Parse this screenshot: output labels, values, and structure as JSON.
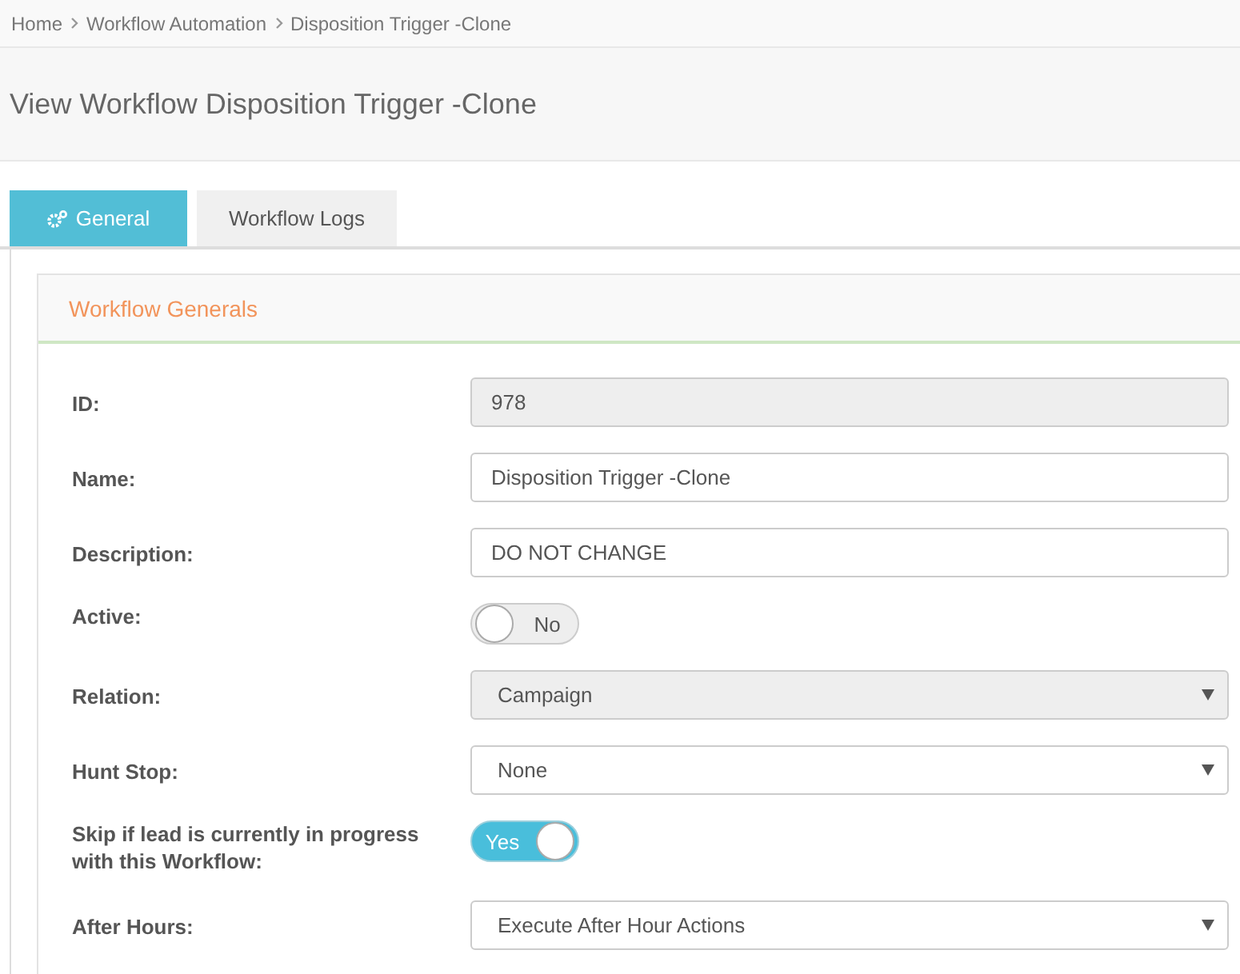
{
  "breadcrumb": [
    "Home",
    "Workflow Automation",
    "Disposition Trigger -Clone"
  ],
  "page_title": "View Workflow Disposition Trigger -Clone",
  "tabs": [
    {
      "label": "General",
      "selected": true
    },
    {
      "label": "Workflow Logs",
      "selected": false
    }
  ],
  "panel": {
    "title": "Workflow Generals",
    "fields": [
      {
        "label": "ID:",
        "kind": "text",
        "value": "978",
        "disabled": true
      },
      {
        "label": "Name:",
        "kind": "text",
        "value": "Disposition Trigger -Clone",
        "disabled": false
      },
      {
        "label": "Description:",
        "kind": "text",
        "value": "DO NOT CHANGE",
        "disabled": false
      },
      {
        "label": "Active:",
        "kind": "toggle",
        "on": false,
        "text": "No"
      },
      {
        "label": "Relation:",
        "kind": "select",
        "value": "Campaign",
        "disabled": true
      },
      {
        "label": "Hunt Stop:",
        "kind": "select",
        "value": "None",
        "disabled": false
      },
      {
        "label": "Skip if lead is currently in progress with this Workflow:",
        "kind": "toggle",
        "on": true,
        "text": "Yes"
      },
      {
        "label": "After Hours:",
        "kind": "select",
        "value": "Execute After Hour Actions",
        "disabled": false
      }
    ]
  }
}
